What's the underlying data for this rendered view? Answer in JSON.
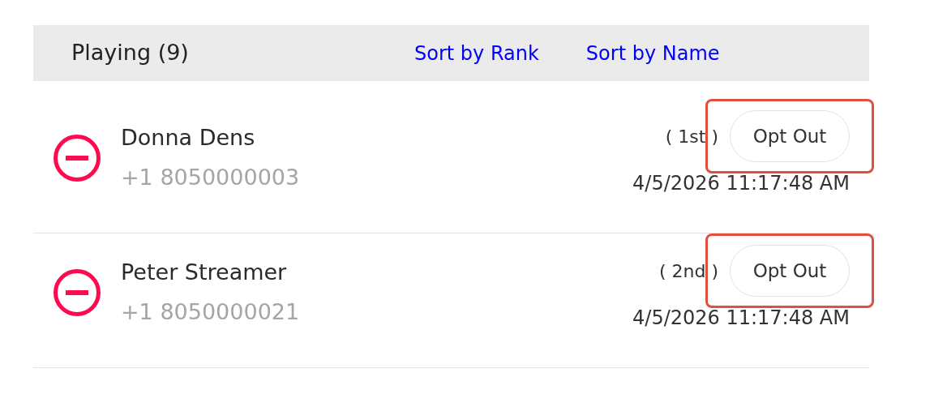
{
  "header": {
    "title": "Playing (9)",
    "sort_links": [
      "Sort by Rank",
      "Sort by Name"
    ]
  },
  "players": [
    {
      "name": "Donna Dens",
      "phone": "+1 8050000003",
      "rank": "( 1st )",
      "time": "4/5/2026 11:17:48 AM",
      "button": "Opt Out",
      "highlighted": true
    },
    {
      "name": "Peter Streamer",
      "phone": "+1 8050000021",
      "rank": "( 2nd )",
      "time": "4/5/2026 11:17:48 AM",
      "button": "Opt Out",
      "highlighted": true
    }
  ]
}
